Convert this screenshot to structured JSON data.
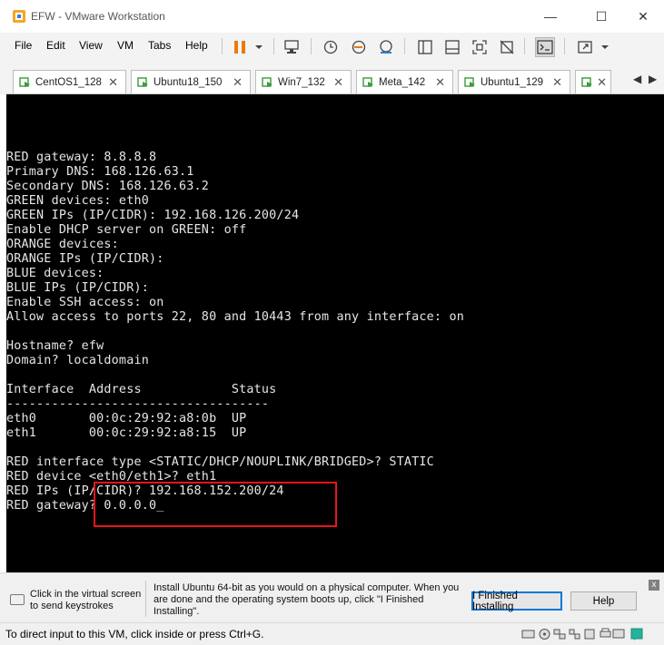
{
  "window": {
    "title": "EFW - VMware Workstation",
    "minimize_glyph": "—",
    "maximize_glyph": "☐",
    "close_glyph": "✕"
  },
  "menu": {
    "items": [
      "File",
      "Edit",
      "View",
      "VM",
      "Tabs",
      "Help"
    ]
  },
  "toolbar": {
    "icons": [
      "pause-icon",
      "dropdown-icon",
      "send-ctrl-alt-del-icon",
      "snapshot-icon",
      "revert-snapshot-icon",
      "snapshot-manager-icon",
      "library-icon",
      "thumbnail-icon",
      "fullscreen-icon",
      "unity-icon",
      "console-view-icon",
      "stretch-icon"
    ],
    "accent_color": "#e87b0c"
  },
  "tabs": [
    {
      "label": "CentOS1_128",
      "close": "✕"
    },
    {
      "label": "Ubuntu18_150",
      "close": "✕"
    },
    {
      "label": "Win7_132",
      "close": "✕"
    },
    {
      "label": "Meta_142",
      "close": "✕"
    },
    {
      "label": "Ubuntu1_129",
      "close": "✕"
    },
    {
      "label": "",
      "close": "✕"
    }
  ],
  "tab_nav": {
    "left": "◀",
    "right": "▶"
  },
  "console": {
    "lines": [
      "RED gateway: 8.8.8.8",
      "Primary DNS: 168.126.63.1",
      "Secondary DNS: 168.126.63.2",
      "GREEN devices: eth0",
      "GREEN IPs (IP/CIDR): 192.168.126.200/24",
      "Enable DHCP server on GREEN: off",
      "ORANGE devices:",
      "ORANGE IPs (IP/CIDR):",
      "BLUE devices:",
      "BLUE IPs (IP/CIDR):",
      "Enable SSH access: on",
      "Allow access to ports 22, 80 and 10443 from any interface: on",
      "",
      "Hostname? efw",
      "Domain? localdomain",
      "",
      "Interface  Address            Status",
      "-----------------------------------",
      "eth0       00:0c:29:92:a8:0b  UP",
      "eth1       00:0c:29:92:a8:15  UP",
      "",
      "RED interface type <STATIC/DHCP/NOUPLINK/BRIDGED>? STATIC",
      "RED device <eth0/eth1>? eth1",
      "RED IPs (IP/CIDR)? 192.168.152.200/24",
      "RED gateway? 0.0.0.0_"
    ],
    "highlight_color": "#e8141e"
  },
  "hint": {
    "left_line1": "Click in the virtual screen",
    "left_line2": "to send keystrokes",
    "message": "Install Ubuntu 64-bit as you would on a physical computer. When you are done and the operating system boots up, click \"I Finished Installing\".",
    "finished_button": "I Finished Installing",
    "help_button": "Help",
    "close": "x"
  },
  "status": {
    "text": "To direct input to this VM, click inside or press Ctrl+G.",
    "icons": [
      "hard-disk-icon",
      "cd-drive-icon",
      "network-icon",
      "usb-icon",
      "sound-icon",
      "printer-icon",
      "display-icon",
      "message-icon"
    ]
  }
}
